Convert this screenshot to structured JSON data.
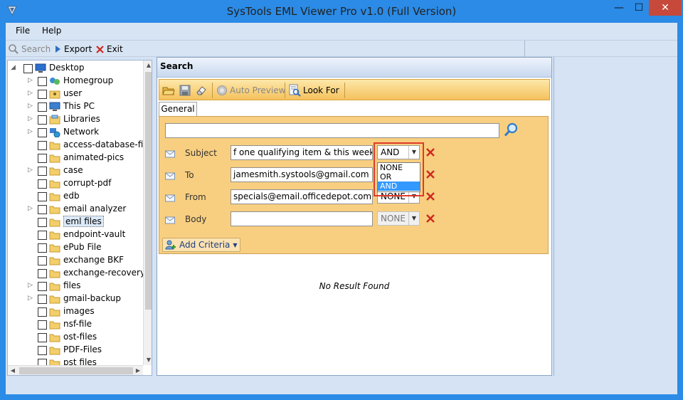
{
  "window": {
    "title": "SysTools EML Viewer Pro v1.0 (Full Version)",
    "minimize": "—",
    "maximize": "☐",
    "close": "✕"
  },
  "menu": {
    "file": "File",
    "help": "Help"
  },
  "toolbar": {
    "search_label": "Search",
    "export_label": "Export",
    "exit_label": "Exit"
  },
  "tree": {
    "root": "Desktop",
    "items": [
      {
        "label": "Homegroup",
        "icon": "homegroup-icon",
        "expandable": true
      },
      {
        "label": "user",
        "icon": "user-folder-icon",
        "expandable": true
      },
      {
        "label": "This PC",
        "icon": "computer-icon",
        "expandable": true
      },
      {
        "label": "Libraries",
        "icon": "libraries-icon",
        "expandable": true
      },
      {
        "label": "Network",
        "icon": "network-icon",
        "expandable": true
      },
      {
        "label": "access-database-file",
        "icon": "folder-icon",
        "expandable": false
      },
      {
        "label": "animated-pics",
        "icon": "folder-icon",
        "expandable": false
      },
      {
        "label": "case",
        "icon": "folder-icon",
        "expandable": true
      },
      {
        "label": "corrupt-pdf",
        "icon": "folder-icon",
        "expandable": false
      },
      {
        "label": "edb",
        "icon": "folder-icon",
        "expandable": false
      },
      {
        "label": "email analyzer",
        "icon": "folder-icon",
        "expandable": true
      },
      {
        "label": "eml files",
        "icon": "folder-icon",
        "expandable": false,
        "selected": true
      },
      {
        "label": "endpoint-vault",
        "icon": "folder-icon",
        "expandable": false
      },
      {
        "label": "ePub File",
        "icon": "folder-icon",
        "expandable": false
      },
      {
        "label": "exchange BKF",
        "icon": "folder-icon",
        "expandable": false
      },
      {
        "label": "exchange-recovery",
        "icon": "folder-icon",
        "expandable": false
      },
      {
        "label": "files",
        "icon": "folder-icon",
        "expandable": true
      },
      {
        "label": "gmail-backup",
        "icon": "folder-icon",
        "expandable": true
      },
      {
        "label": "images",
        "icon": "folder-icon",
        "expandable": false
      },
      {
        "label": "nsf-file",
        "icon": "folder-icon",
        "expandable": false
      },
      {
        "label": "ost-files",
        "icon": "folder-icon",
        "expandable": false
      },
      {
        "label": "PDF-Files",
        "icon": "folder-icon",
        "expandable": false
      },
      {
        "label": "pst files",
        "icon": "folder-icon",
        "expandable": false
      }
    ]
  },
  "search_panel": {
    "header": "Search",
    "auto_preview": "Auto Preview",
    "look_for": "Look For",
    "tab_general": "General",
    "main_query": "",
    "criteria": [
      {
        "label": "Subject",
        "value": "f one qualifying item & this week's ad",
        "operator": "AND",
        "operator_enabled": true
      },
      {
        "label": "To",
        "value": "jamesmith.systools@gmail.com",
        "operator": "",
        "operator_enabled": true
      },
      {
        "label": "From",
        "value": "specials@email.officedepot.com",
        "operator": "NONE",
        "operator_enabled": true
      },
      {
        "label": "Body",
        "value": "",
        "operator": "NONE",
        "operator_enabled": false
      }
    ],
    "operator_options": [
      "NONE",
      "OR",
      "AND"
    ],
    "operator_selected": "AND",
    "add_criteria": "Add Criteria",
    "no_result": "No Result Found"
  },
  "colors": {
    "title_bar": "#2b8be6",
    "close_button": "#c7493b",
    "criteria_background": "#f8cf80",
    "highlight_red": "#e03a2a",
    "delete_x": "#d0281f"
  }
}
